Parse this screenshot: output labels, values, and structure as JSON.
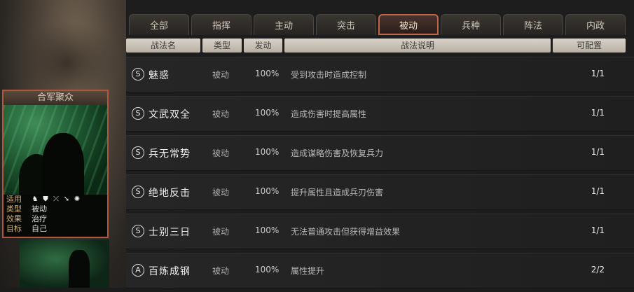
{
  "tabs": [
    "全部",
    "指挥",
    "主动",
    "突击",
    "被动",
    "兵种",
    "阵法",
    "内政"
  ],
  "active_tab": 4,
  "headers": [
    "战法名",
    "类型",
    "发动",
    "战法说明",
    "可配置"
  ],
  "card": {
    "title": "合军聚众",
    "rows": [
      {
        "key": "适用",
        "value": ""
      },
      {
        "key": "类型",
        "value": "被动"
      },
      {
        "key": "效果",
        "value": "治疗"
      },
      {
        "key": "目标",
        "value": "自己"
      }
    ],
    "troop_icons": [
      "cavalry-icon",
      "shield-icon",
      "bow-icon",
      "spear-icon",
      "vehicle-icon"
    ]
  },
  "skills": [
    {
      "rank": "S",
      "name": "魅惑",
      "type": "被动",
      "trigger": "100%",
      "desc": "受到攻击时造成控制",
      "avail": "1/1"
    },
    {
      "rank": "S",
      "name": "文武双全",
      "type": "被动",
      "trigger": "100%",
      "desc": "造成伤害时提高属性",
      "avail": "1/1"
    },
    {
      "rank": "S",
      "name": "兵无常势",
      "type": "被动",
      "trigger": "100%",
      "desc": "造成谋略伤害及恢复兵力",
      "avail": "1/1"
    },
    {
      "rank": "S",
      "name": "绝地反击",
      "type": "被动",
      "trigger": "100%",
      "desc": "提升属性且造成兵刃伤害",
      "avail": "1/1"
    },
    {
      "rank": "S",
      "name": "士别三日",
      "type": "被动",
      "trigger": "100%",
      "desc": "无法普通攻击但获得增益效果",
      "avail": "1/1"
    },
    {
      "rank": "A",
      "name": "百炼成钢",
      "type": "被动",
      "trigger": "100%",
      "desc": "属性提升",
      "avail": "2/2"
    }
  ]
}
